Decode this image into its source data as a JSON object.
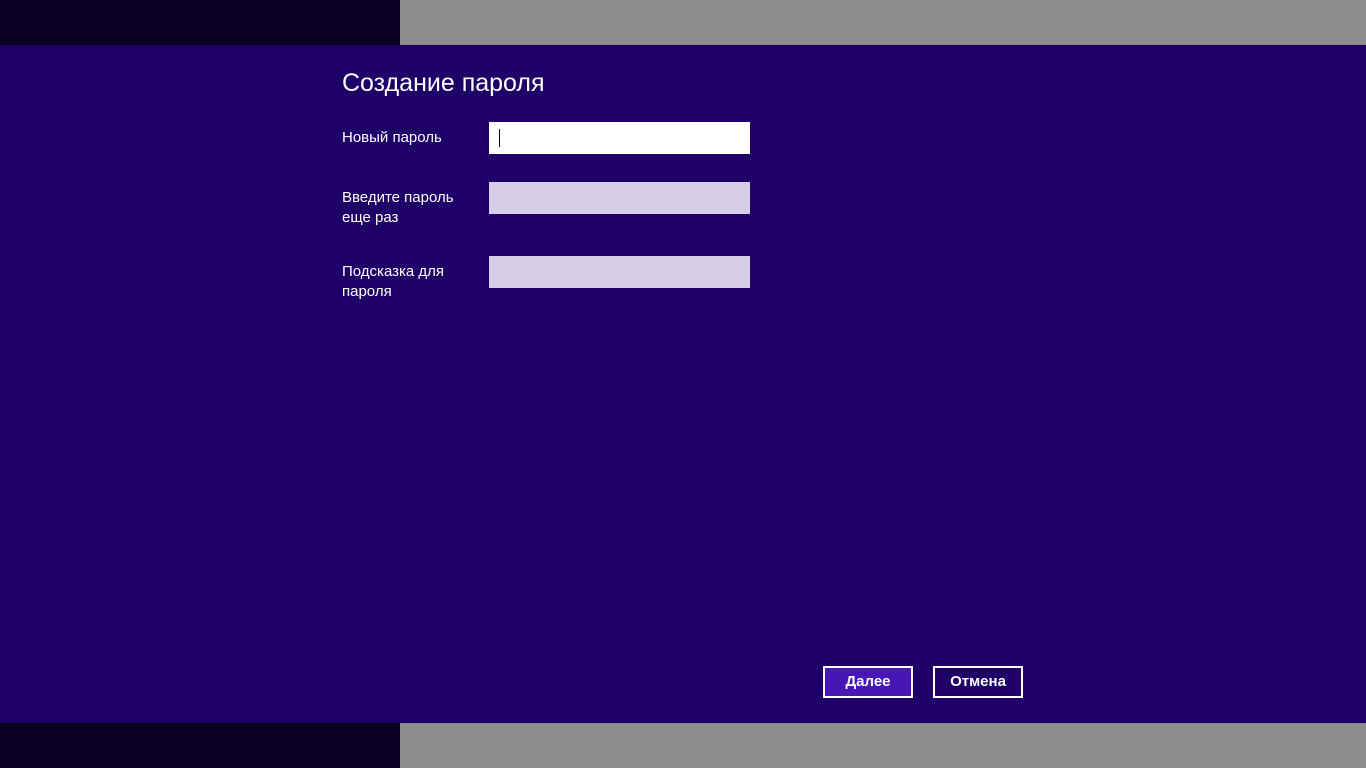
{
  "dialog": {
    "title": "Создание пароля",
    "fields": [
      {
        "label": "Новый пароль",
        "value": "",
        "placeholder": ""
      },
      {
        "label": "Введите пароль еще раз",
        "value": "",
        "placeholder": ""
      },
      {
        "label": "Подсказка для пароля",
        "value": "",
        "placeholder": ""
      }
    ]
  },
  "buttons": {
    "next_label": "Далее",
    "cancel_label": "Отмена"
  },
  "colors": {
    "background": "#1f0068",
    "accent": "#4617b4",
    "field_active": "#ffffff",
    "field_inactive": "#d6cee6",
    "band_dark": "#0b0223",
    "band_gray": "#8c8c8c"
  }
}
